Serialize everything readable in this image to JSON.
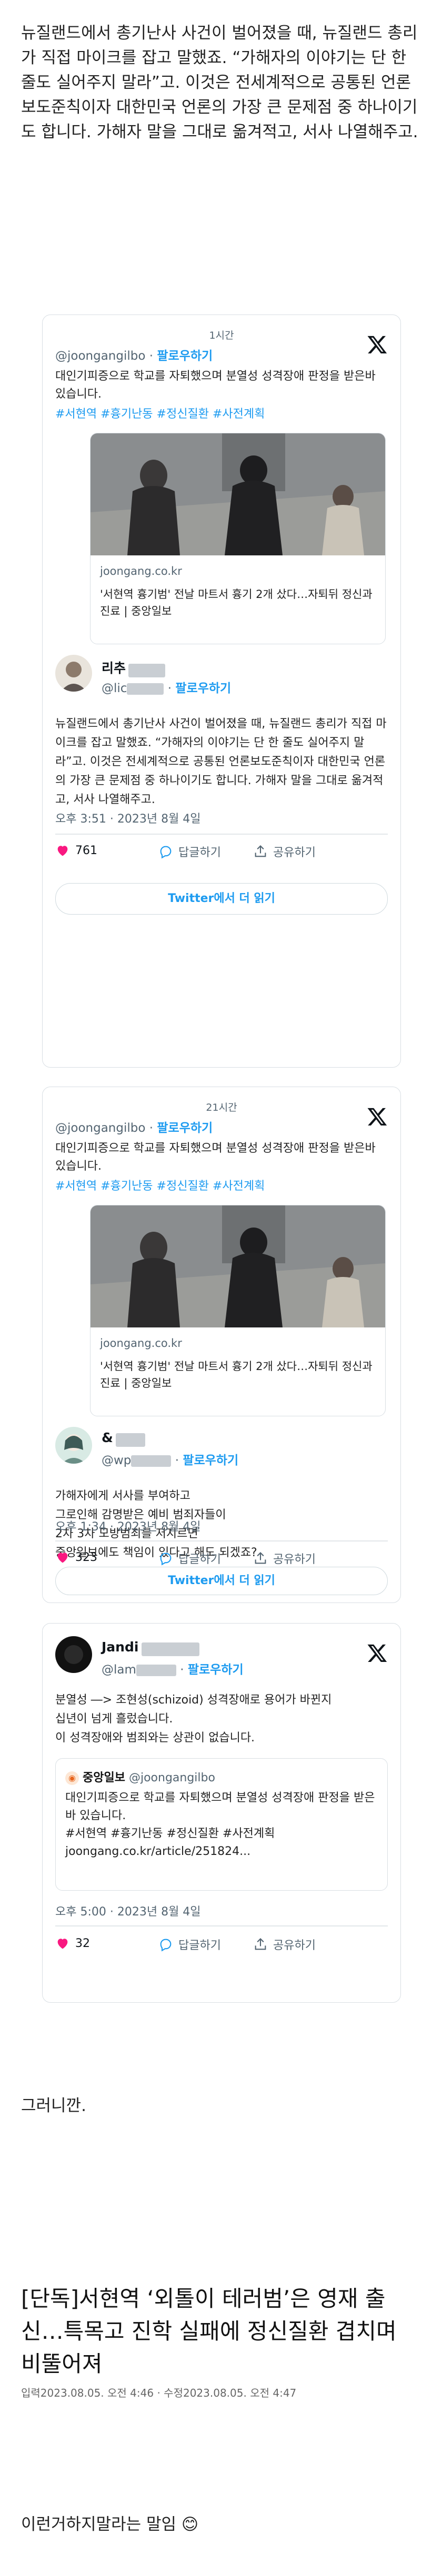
{
  "intro_text": "뉴질랜드에서 총기난사 사건이 벌어졌을 때, 뉴질랜드 총리가 직접 마이크를 잡고 말했죠. “가해자의 이야기는 단 한 줄도 실어주지 말라”고. 이것은 전세계적으로 공통된 언론보도준칙이자 대한민국 언론의 가장 큰 문제점 중 하나이기도 합니다. 가해자 말을 그대로 옮겨적고, 서사 나열해주고.",
  "tweet1": {
    "quoted": {
      "time_ago": "1시간",
      "handle": "@joongangilbo",
      "follow": "팔로우하기",
      "text": "대인기피증으로 학교를 자퇴했으며 분열성 성격장애 판정을 받은바 있습니다.",
      "tags": "#서현역 #흉기난동 #정신질환 #사전계획",
      "link_domain": "joongang.co.kr",
      "link_title": "'서현역 흉기범' 전날 마트서 흉기 2개 샀다…자퇴뒤 정신과 진료 | 중앙일보"
    },
    "name": "리추",
    "handle": "@lic",
    "follow": "팔로우하기",
    "body": "뉴질랜드에서 총기난사 사건이 벌어졌을 때, 뉴질랜드 총리가 직접 마이크를 잡고 말했죠. “가해자의 이야기는 단 한 줄도 실어주지 말라”고. 이것은 전세계적으로 공통된 언론보도준칙이자 대한민국 언론의 가장 큰 문제점 중 하나이기도 합니다. 가해자 말을 그대로 옮겨적고, 서사 나열해주고.",
    "timestamp": "오후 3:51 · 2023년 8월 4일",
    "likes": "761",
    "reply": "답글하기",
    "share": "공유하기",
    "read_more": "Twitter에서 더 읽기"
  },
  "tweet2": {
    "quoted": {
      "time_ago": "21시간",
      "handle": "@joongangilbo",
      "follow": "팔로우하기",
      "text": "대인기피증으로 학교를 자퇴했으며 분열성 성격장애 판정을 받은바 있습니다.",
      "tags": "#서현역 #흉기난동 #정신질환 #사전계획",
      "link_domain": "joongang.co.kr",
      "link_title": "'서현역 흉기범' 전날 마트서 흉기 2개 샀다…자퇴뒤 정신과 진료 | 중앙일보"
    },
    "name": "&",
    "handle": "@wp",
    "follow": "팔로우하기",
    "body_lines": [
      "가해자에게 서사를 부여하고",
      "그로인해 감명받은 예비 범죄자들이",
      "2차 3차 모방범죄를 저지르면",
      "중앙일보에도 책임이 있다고 해도 되겠죠?"
    ],
    "timestamp": "오후 1:34 · 2023년 8월 4일",
    "likes": "323",
    "reply": "답글하기",
    "share": "공유하기",
    "read_more": "Twitter에서 더 읽기"
  },
  "tweet3": {
    "name": "Jandi",
    "handle": "@lam",
    "follow": "팔로우하기",
    "body_lines": [
      "분열성 ―> 조현성(schizoid) 성격장애로 용어가 바뀐지",
      "십년이 넘게 흘렀습니다.",
      "이 성격장애와 범죄와는 상관이 없습니다."
    ],
    "quote": {
      "name": "중앙일보",
      "handle": "@joongangilbo",
      "text": "대인기피증으로 학교를 자퇴했으며 분열성 성격장애 판정을 받은바 있습니다.",
      "tags": "#서현역 #흉기난동 #정신질환 #사전계획",
      "url": "joongang.co.kr/article/251824..."
    },
    "timestamp": "오후 5:00 · 2023년 8월 4일",
    "likes": "32",
    "reply": "답글하기",
    "share": "공유하기"
  },
  "after_text": "그러니깐.",
  "article": {
    "title": "[단독]서현역 ‘외톨이 테러범’은 영재 출신…특목고 진학 실패에 정신질환 겹치며 비뚤어져",
    "meta": "입력2023.08.05. 오전 4:46 · 수정2023.08.05. 오전 4:47"
  },
  "closing_text": "이런거하지말라는 말임 😊",
  "colors": {
    "link": "#1d9bf0",
    "like": "#f91880",
    "border": "#d8dee3"
  }
}
